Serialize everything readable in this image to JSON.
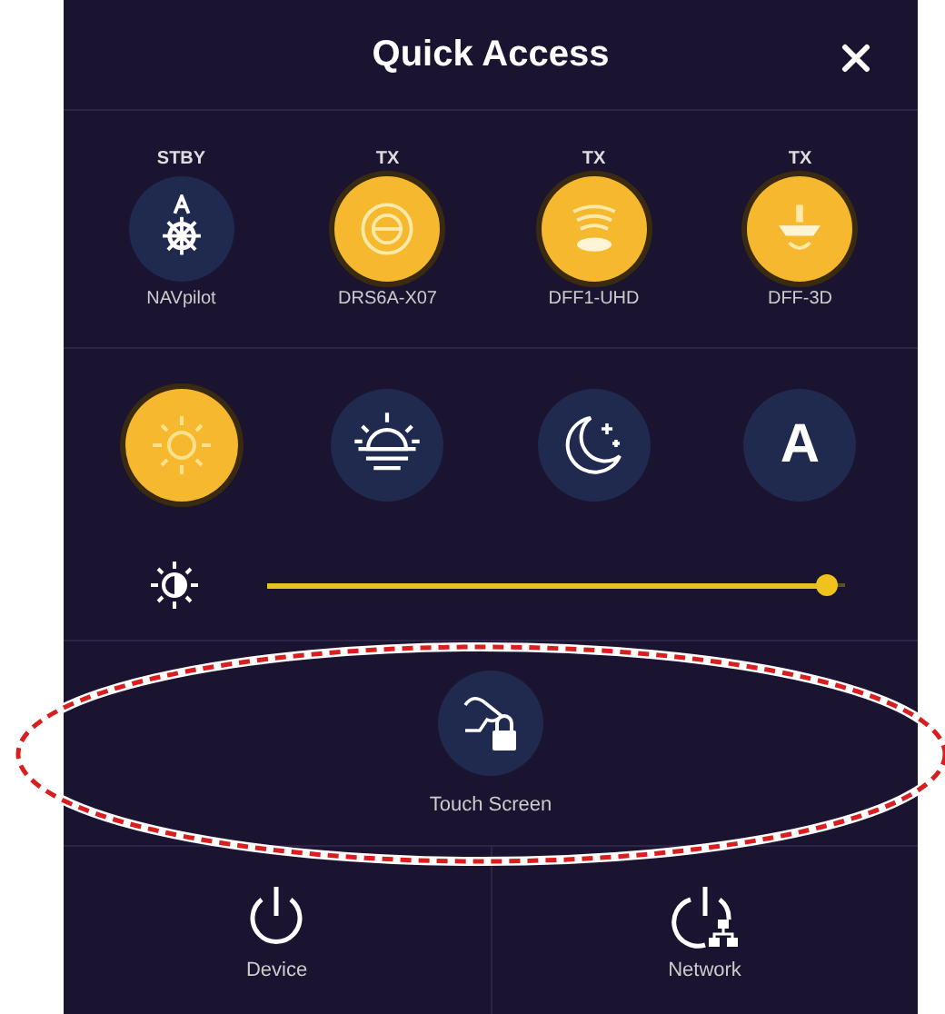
{
  "title": "Quick Access",
  "devices": [
    {
      "status": "STBY",
      "name": "NAVpilot",
      "kind": "helm",
      "active": false
    },
    {
      "status": "TX",
      "name": "DRS6A-X07",
      "kind": "radar",
      "active": true
    },
    {
      "status": "TX",
      "name": "DFF1-UHD",
      "kind": "sonar",
      "active": true
    },
    {
      "status": "TX",
      "name": "DFF-3D",
      "kind": "sounder",
      "active": true
    }
  ],
  "modes": [
    {
      "kind": "day",
      "selected": true
    },
    {
      "kind": "dusk",
      "selected": false
    },
    {
      "kind": "night",
      "selected": false
    },
    {
      "kind": "auto",
      "label": "A",
      "selected": false
    }
  ],
  "brightness": {
    "level": 0.97
  },
  "touch_screen": {
    "label": "Touch Screen"
  },
  "bottom_buttons": [
    {
      "kind": "power",
      "label": "Device"
    },
    {
      "kind": "network",
      "label": "Network"
    }
  ]
}
